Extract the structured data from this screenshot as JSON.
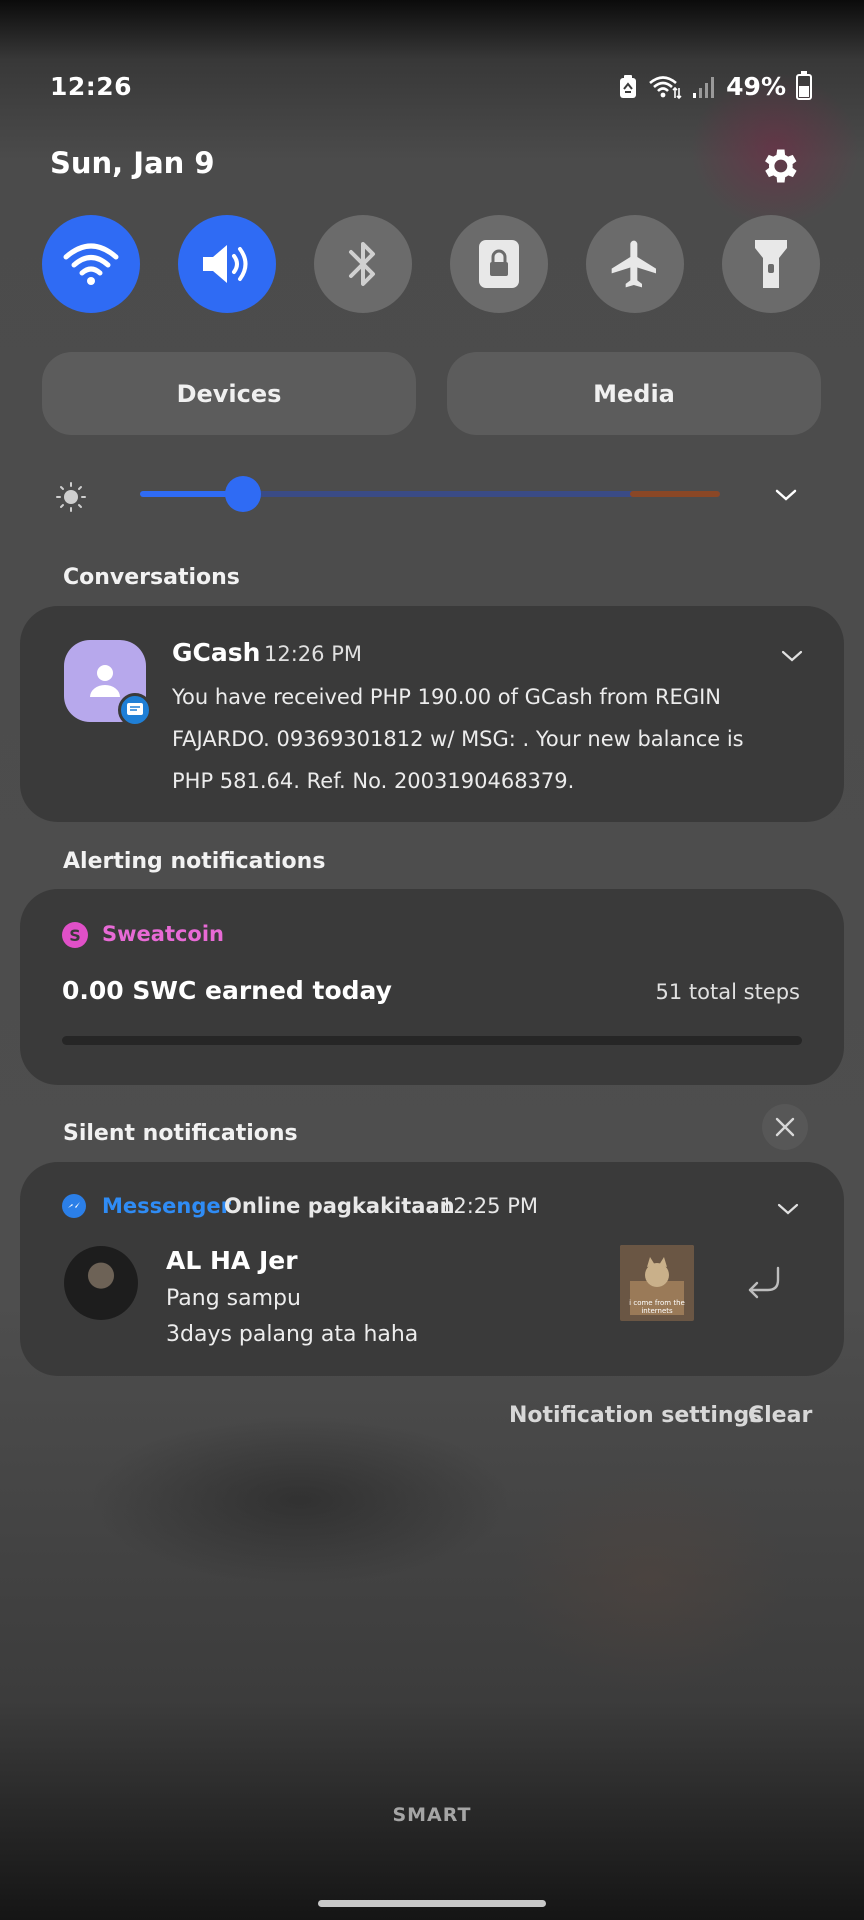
{
  "status_bar": {
    "time": "12:26",
    "battery": "49%"
  },
  "header": {
    "date": "Sun, Jan 9"
  },
  "quick_toggles": [
    {
      "name": "wifi",
      "icon": "wifi-icon",
      "state": "on"
    },
    {
      "name": "sound",
      "icon": "volume-icon",
      "state": "on"
    },
    {
      "name": "bluetooth",
      "icon": "bluetooth-icon",
      "state": "off"
    },
    {
      "name": "portrait-lock",
      "icon": "lock-icon",
      "state": "off"
    },
    {
      "name": "airplane",
      "icon": "airplane-icon",
      "state": "off"
    },
    {
      "name": "flashlight",
      "icon": "flashlight-icon",
      "state": "off"
    }
  ],
  "panel_buttons": {
    "devices": "Devices",
    "media": "Media"
  },
  "brightness": {
    "level": 0.18
  },
  "sections": {
    "conversations": "Conversations",
    "alerting": "Alerting notifications",
    "silent": "Silent notifications"
  },
  "gcash": {
    "app": "GCash",
    "time": "12:26 PM",
    "message": "You have received PHP 190.00 of GCash from REGIN FAJARDO. 09369301812 w/ MSG: . Your new balance is PHP 581.64. Ref. No. 2003190468379."
  },
  "sweatcoin": {
    "app": "Sweatcoin",
    "icon_letter": "S",
    "earned": "0.00 SWC earned today",
    "steps": "51 total steps",
    "progress": 0
  },
  "messenger": {
    "app": "Messenger",
    "subtitle": "Online pagkakitaan",
    "time": "12:25 PM",
    "sender": "AL HA Jer",
    "line1": "Pang sampu",
    "line2": "3days palang ata haha",
    "thumb_caption": "i come from the internets"
  },
  "footer": {
    "notification_settings": "Notification settings",
    "clear": "Clear"
  },
  "carrier": "SMART",
  "colors": {
    "accent": "#2f6bf4",
    "sweatcoin": "#e86ad6",
    "messenger": "#2f8cf5"
  }
}
